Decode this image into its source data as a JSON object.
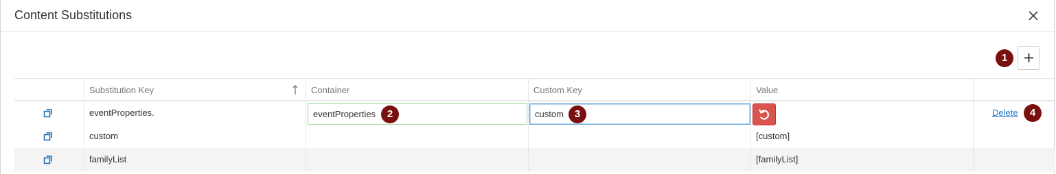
{
  "dialog": {
    "title": "Content Substitutions",
    "close_icon": "close-icon",
    "add_icon": "plus-icon"
  },
  "markers": [
    "1",
    "2",
    "3",
    "4"
  ],
  "table": {
    "columns": [
      "Substitution Key",
      "Container",
      "Custom Key",
      "Value"
    ],
    "sort_icon": "sort-ascending-arrow-icon",
    "rows": [
      {
        "key": "eventProperties.",
        "container": "eventProperties",
        "custom_key": "custom",
        "value": "",
        "action": "Delete",
        "editing": true
      },
      {
        "key": "custom",
        "container": "",
        "custom_key": "",
        "value": "[custom]"
      },
      {
        "key": "familyList",
        "container": "",
        "custom_key": "",
        "value": "[familyList]"
      }
    ]
  },
  "colors": {
    "marker": "#7a0f0f",
    "undo_button": "#d9534f",
    "link": "#1f77c4",
    "container_input_border": "#9fd49f",
    "custom_input_border": "#5a9fd8"
  }
}
